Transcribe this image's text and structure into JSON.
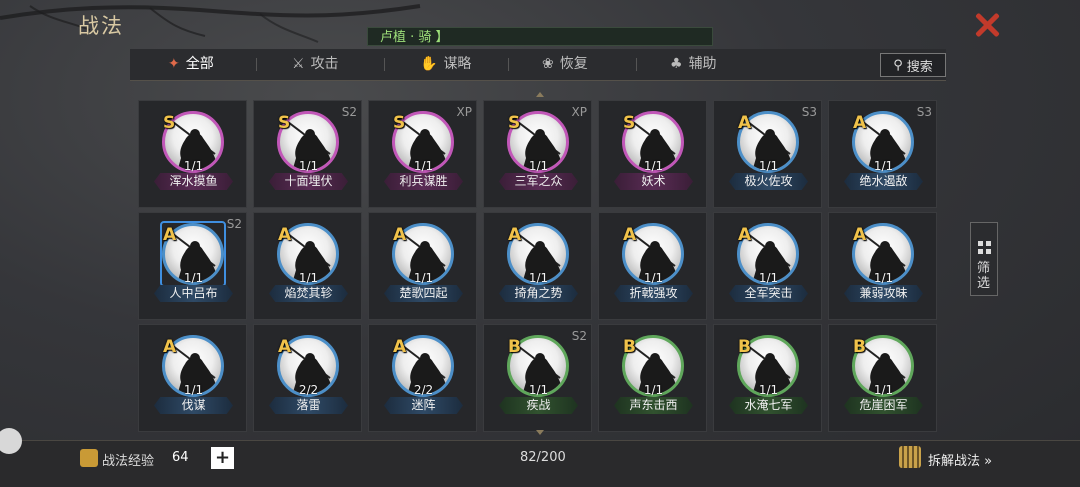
{
  "title": "战法",
  "hero_label": "卢植 · 骑 】",
  "tabs": [
    {
      "label": "全部",
      "icon": "all-icon",
      "active": true
    },
    {
      "label": "攻击",
      "icon": "crossed-swords-icon",
      "active": false
    },
    {
      "label": "谋略",
      "icon": "scheme-icon",
      "active": false
    },
    {
      "label": "恢复",
      "icon": "heal-icon",
      "active": false
    },
    {
      "label": "辅助",
      "icon": "support-icon",
      "active": false
    }
  ],
  "search_label": "搜索",
  "filter_label": "筛选",
  "cards": [
    {
      "grade": "S",
      "season": "",
      "level": "1/1",
      "name": "浑水摸鱼"
    },
    {
      "grade": "S",
      "season": "S2",
      "level": "1/1",
      "name": "十面埋伏"
    },
    {
      "grade": "S",
      "season": "XP",
      "level": "1/1",
      "name": "利兵谋胜"
    },
    {
      "grade": "S",
      "season": "XP",
      "level": "1/1",
      "name": "三军之众"
    },
    {
      "grade": "S",
      "season": "",
      "level": "1/1",
      "name": "妖术"
    },
    {
      "grade": "A",
      "season": "S3",
      "level": "1/1",
      "name": "极火佐攻"
    },
    {
      "grade": "A",
      "season": "S3",
      "level": "1/1",
      "name": "绝水遏敌"
    },
    {
      "grade": "A",
      "season": "S2",
      "level": "1/1",
      "name": "人中吕布",
      "selected": true
    },
    {
      "grade": "A",
      "season": "",
      "level": "1/1",
      "name": "焰焚其轸"
    },
    {
      "grade": "A",
      "season": "",
      "level": "1/1",
      "name": "楚歌四起"
    },
    {
      "grade": "A",
      "season": "",
      "level": "1/1",
      "name": "掎角之势"
    },
    {
      "grade": "A",
      "season": "",
      "level": "1/1",
      "name": "折戟强攻"
    },
    {
      "grade": "A",
      "season": "",
      "level": "1/1",
      "name": "全军突击"
    },
    {
      "grade": "A",
      "season": "",
      "level": "1/1",
      "name": "兼弱攻昧"
    },
    {
      "grade": "A",
      "season": "",
      "level": "1/1",
      "name": "伐谋"
    },
    {
      "grade": "A",
      "season": "",
      "level": "2/2",
      "name": "落雷"
    },
    {
      "grade": "A",
      "season": "",
      "level": "2/2",
      "name": "迷阵"
    },
    {
      "grade": "B",
      "season": "S2",
      "level": "1/1",
      "name": "疾战"
    },
    {
      "grade": "B",
      "season": "",
      "level": "1/1",
      "name": "声东击西"
    },
    {
      "grade": "B",
      "season": "",
      "level": "1/1",
      "name": "水淹七军"
    },
    {
      "grade": "B",
      "season": "",
      "level": "1/1",
      "name": "危崖困军"
    }
  ],
  "footer": {
    "exp_label": "战法经验",
    "exp_value": "64",
    "plus_label": "+",
    "count": "82/200",
    "disassemble_label": "拆解战法 »"
  },
  "colors": {
    "grade_S": "#c157b8",
    "grade_A": "#4c8fc8",
    "grade_B": "#5fa75b",
    "grade_text": "#f0c24a",
    "close": "#c23a2b",
    "hero_text": "#9ee07a"
  }
}
